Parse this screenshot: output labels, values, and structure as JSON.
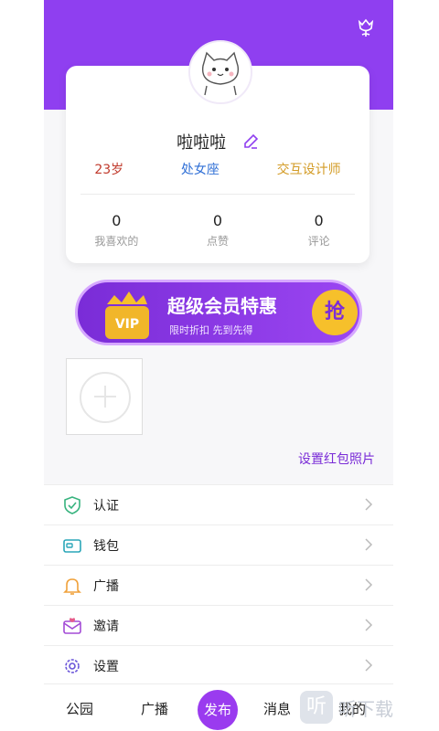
{
  "header": {
    "icon": "tulip-icon"
  },
  "profile": {
    "name": "啦啦啦",
    "tags": {
      "age": "23岁",
      "sign": "处女座",
      "job": "交互设计师"
    },
    "stats": [
      {
        "value": "0",
        "label": "我喜欢的"
      },
      {
        "value": "0",
        "label": "点赞"
      },
      {
        "value": "0",
        "label": "评论"
      }
    ]
  },
  "vip_banner": {
    "badge": "VIP",
    "title": "超级会员特惠",
    "subtitle": "限时折扣  先到先得",
    "button": "抢"
  },
  "photos": {
    "link": "设置红包照片"
  },
  "menu": {
    "items": [
      {
        "label": "认证",
        "icon": "shield-check-icon"
      },
      {
        "label": "钱包",
        "icon": "wallet-icon"
      },
      {
        "label": "广播",
        "icon": "bell-icon"
      },
      {
        "label": "邀请",
        "icon": "envelope-icon"
      },
      {
        "label": "设置",
        "icon": "gear-icon"
      }
    ]
  },
  "tabbar": {
    "tabs": [
      "公园",
      "广播",
      "发布",
      "消息",
      "我的"
    ],
    "active": "我的"
  },
  "watermark": {
    "icon_text": "听",
    "text": "听下载"
  },
  "colors": {
    "primary": "#8f3ff0",
    "vip_gold": "#f6c02b",
    "age": "#c0392b",
    "sign": "#2f6fd6",
    "job": "#d39b25"
  }
}
